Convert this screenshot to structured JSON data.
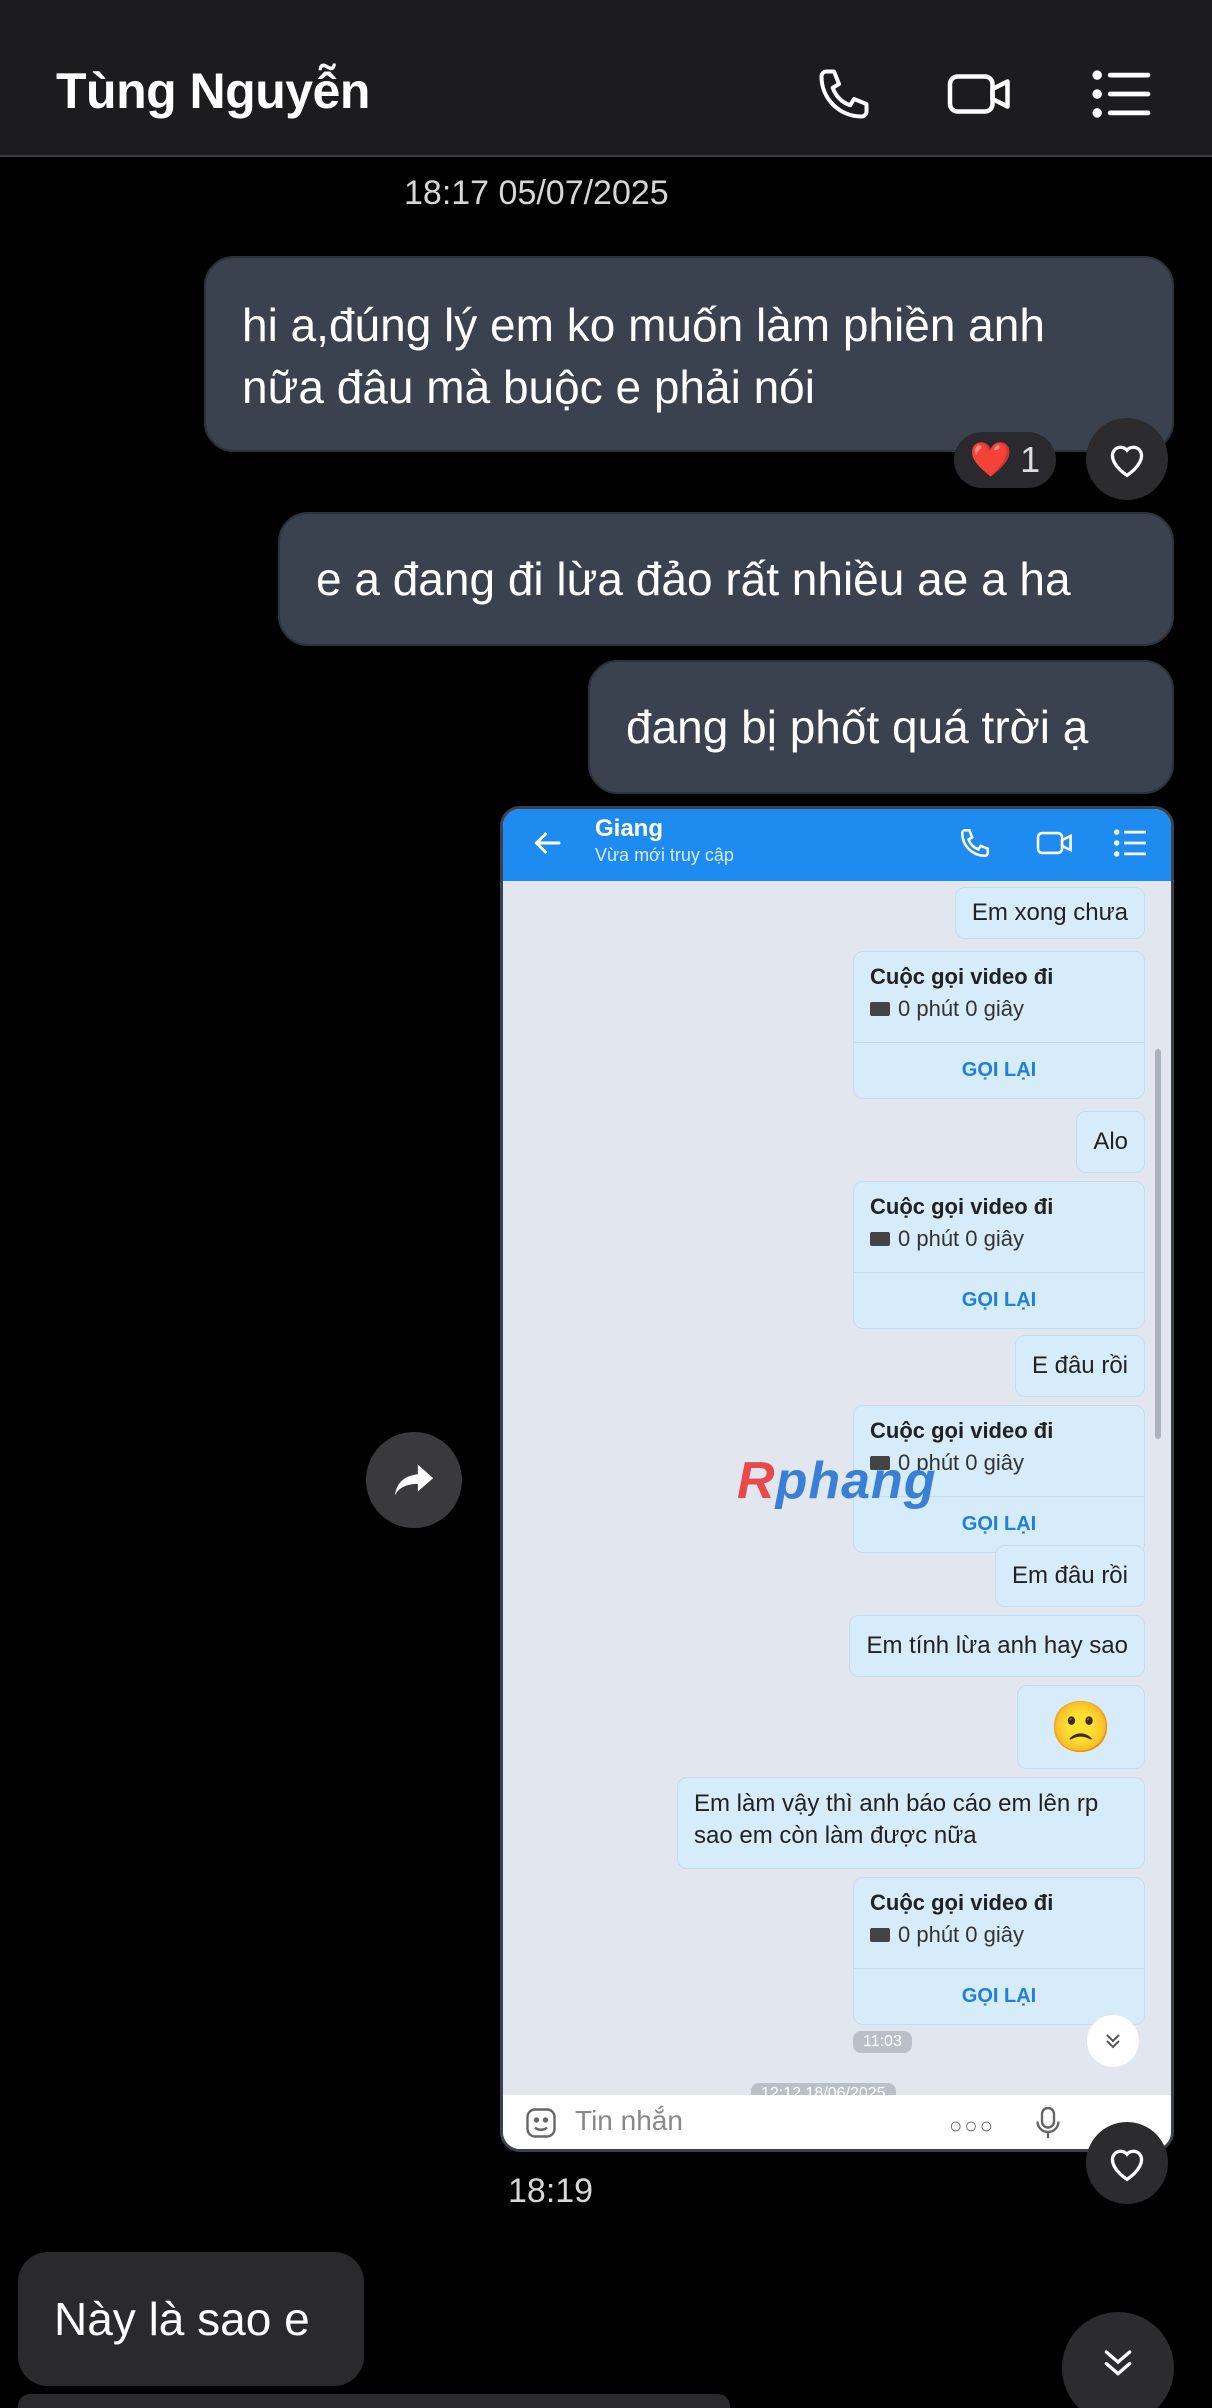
{
  "header": {
    "contact_name": "Tùng Nguyễn",
    "icons": [
      "phone-icon",
      "video-call-icon",
      "menu-icon"
    ]
  },
  "thread": {
    "timestamp_top": "18:17 05/07/2025",
    "messages_out": [
      {
        "line1": "hi a,đúng lý em ko muốn làm phiền anh",
        "line2": "nữa đâu mà buộc e phải nói"
      },
      {
        "line1": "e a đang đi lừa đảo rất nhiều ae a ha"
      },
      {
        "line1": "đang bị phốt quá trời ạ"
      }
    ],
    "reaction": {
      "emoji": "❤️",
      "count": "1"
    },
    "image_time": "18:19",
    "message_in": "Này là sao e"
  },
  "shot": {
    "contact": "Giang",
    "status": "Vừa mới truy cập",
    "msg_em_xong_chua": "Em xong chưa",
    "call_title": "Cuộc gọi video đi",
    "call_duration": "0 phút 0 giây",
    "call_back": "GỌI LẠI",
    "msg_alo": "Alo",
    "msg_e_dau_roi": "E đâu rồi",
    "msg_em_dau_roi": "Em đâu rồi",
    "msg_lua": "Em tính lừa anh hay sao",
    "emoji": "🙁",
    "msg_long_1": "Em làm vậy thì anh báo cáo em lên rp",
    "msg_long_2": "sao em còn làm được nữa",
    "time_1103": "11:03",
    "time_bottom": "12:12 18/06/2025",
    "input_placeholder": "Tin nhắn",
    "watermark_r": "R",
    "watermark_rest": "phang"
  },
  "colors": {
    "bubble_out": "#3a4250",
    "header_bg": "#1c1c1e",
    "shot_header": "#1e8bf0",
    "shot_bubble": "#d7ecfb"
  }
}
